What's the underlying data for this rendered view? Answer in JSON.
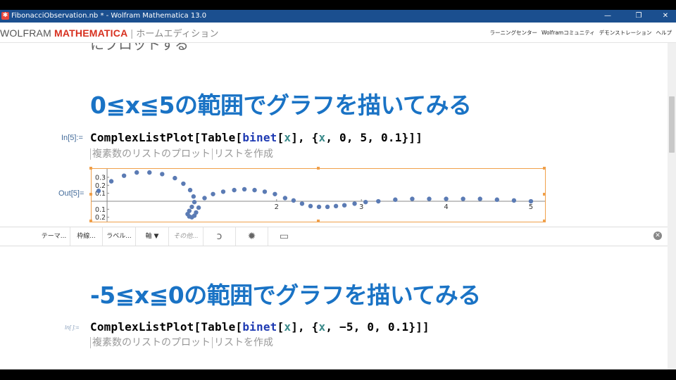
{
  "window": {
    "title": "FibonacciObservation.nb * - Wolfram Mathematica 13.0",
    "icon": "mathematica-star-icon"
  },
  "menubar": {
    "brand_wolfram": "WOLFRAM",
    "brand_mathematica": "MATHEMATICA",
    "brand_sep": "|",
    "edition": "ホームエディション",
    "links": [
      "ラーニングセンター",
      "Wolframコミュニティ",
      "デモンストレーション",
      "ヘルプ"
    ]
  },
  "notebook": {
    "cut_text": "にプロットする",
    "section1_title": "0≦x≦5の範囲でグラフを描いてみる",
    "in5_label": "In[5]:=",
    "out5_label": "Out[5]=",
    "in_blank_label": "In[ ]:=",
    "section2_title": "-5≦x≦0の範囲でグラフを描いてみる",
    "code1": {
      "p1": "ComplexListPlot[Table[",
      "fn": "binet",
      "p2": "[",
      "v1": "x",
      "p3": "], {",
      "v2": "x",
      "p4": ", 0, 5, 0.1}]]"
    },
    "code2": {
      "p1": "ComplexListPlot[Table[",
      "fn": "binet",
      "p2": "[",
      "v1": "x",
      "p3": "], {",
      "v2": "x",
      "p4": ", −5, 0, 0.1}]]"
    },
    "suggest1": [
      "複素数のリストのプロット",
      "リストを作成"
    ],
    "suggest2": [
      "複素数のリストのプロット",
      "リストを作成"
    ]
  },
  "suggestion_bar": {
    "buttons": [
      "テーマ...",
      "枠線...",
      "ラベル...",
      "軸 ▼",
      "その他..."
    ],
    "icons": [
      "iterate-icon",
      "gear-icon",
      "comment-icon",
      "close-icon"
    ]
  },
  "colors": {
    "accent": "#1a73c5",
    "point": "#5b7bb4",
    "selection": "#f0a04b",
    "titlebar": "#1b4f8f"
  },
  "chart_data": {
    "type": "scatter",
    "xlim": [
      -0.15,
      5.1
    ],
    "ylim": [
      -0.22,
      0.37
    ],
    "x_ticks": [
      "2",
      "3",
      "4",
      "5"
    ],
    "y_ticks": [
      "0.3",
      "0.2",
      "0.1",
      "0.1",
      "0.2"
    ],
    "y_tick_values": [
      0.3,
      0.2,
      0.1,
      -0.1,
      -0.2
    ],
    "points": [
      [
        -0.1,
        0.13
      ],
      [
        0.05,
        0.25
      ],
      [
        0.2,
        0.32
      ],
      [
        0.35,
        0.36
      ],
      [
        0.5,
        0.36
      ],
      [
        0.65,
        0.34
      ],
      [
        0.8,
        0.29
      ],
      [
        0.9,
        0.22
      ],
      [
        0.98,
        0.14
      ],
      [
        1.02,
        0.06
      ],
      [
        1.03,
        -0.01
      ],
      [
        1.0,
        -0.07
      ],
      [
        0.97,
        -0.12
      ],
      [
        0.95,
        -0.16
      ],
      [
        0.97,
        -0.19
      ],
      [
        1.0,
        -0.2
      ],
      [
        1.03,
        -0.18
      ],
      [
        1.05,
        -0.14
      ],
      [
        1.08,
        -0.08
      ],
      [
        1.15,
        0.04
      ],
      [
        1.25,
        0.09
      ],
      [
        1.37,
        0.12
      ],
      [
        1.5,
        0.14
      ],
      [
        1.62,
        0.15
      ],
      [
        1.74,
        0.14
      ],
      [
        1.86,
        0.12
      ],
      [
        1.98,
        0.09
      ],
      [
        2.1,
        0.04
      ],
      [
        2.2,
        0.01
      ],
      [
        2.3,
        -0.03
      ],
      [
        2.4,
        -0.06
      ],
      [
        2.5,
        -0.07
      ],
      [
        2.6,
        -0.07
      ],
      [
        2.7,
        -0.06
      ],
      [
        2.8,
        -0.05
      ],
      [
        2.92,
        -0.03
      ],
      [
        3.05,
        -0.01
      ],
      [
        3.2,
        0.0
      ],
      [
        3.4,
        0.02
      ],
      [
        3.6,
        0.03
      ],
      [
        3.8,
        0.03
      ],
      [
        4.0,
        0.03
      ],
      [
        4.2,
        0.03
      ],
      [
        4.4,
        0.03
      ],
      [
        4.6,
        0.02
      ],
      [
        4.8,
        0.01
      ],
      [
        5.0,
        0.0
      ]
    ]
  }
}
